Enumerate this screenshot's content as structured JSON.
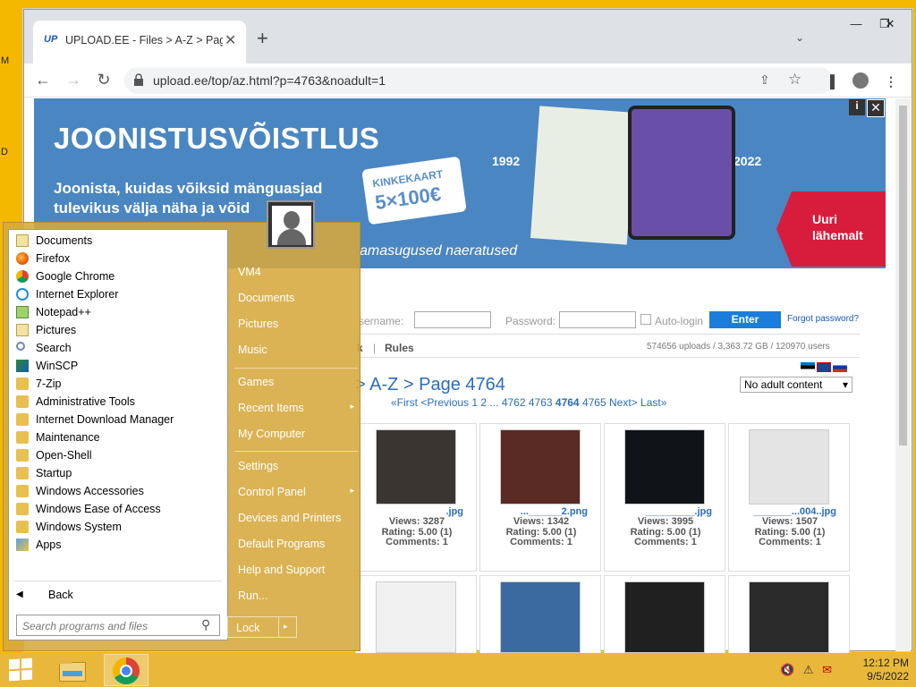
{
  "desktop": {
    "edge_letters": [
      "M",
      "D"
    ]
  },
  "browser": {
    "tab": {
      "favicon_text": "UP",
      "title": "UPLOAD.EE - Files > A-Z > Page",
      "close": "✕"
    },
    "new_tab": "+",
    "url": "upload.ee/top/az.html?p=4763&noadult=1"
  },
  "banner": {
    "heading": "JOONISTUSVÕISTLUS",
    "subtitle": "Joonista, kuidas võiksid mänguasjad tulevikus välja näha ja võid",
    "subtitle_tail": "amasugused naeratused",
    "card_line1": "KINKEKAART",
    "card_line2": "5×100€",
    "year_left": "1992",
    "year_right": "2022",
    "cta": "Uuri lähemalt",
    "info": "i",
    "close": "✕"
  },
  "login": {
    "username_label": "sername:",
    "password_label": "Password:",
    "autologin_label": "Auto-login",
    "enter_label": "Enter",
    "forgot_label": "Forgot password?"
  },
  "nav": {
    "partial_link": "k",
    "separator": "|",
    "rules": "Rules"
  },
  "stats": "574656 uploads  /  3,363.72 GB  /  120970 users",
  "filter": {
    "selected": "No adult content"
  },
  "page_title": "> A-Z > Page 4764",
  "pager": {
    "first": "«First",
    "previous": "<Previous",
    "p1": "1",
    "p2": "2",
    "ellipsis": "...",
    "p4762": "4762",
    "p4763": "4763",
    "current": "4764",
    "p4765": "4765",
    "next": "Next>",
    "last": "Last»"
  },
  "thumbnails": [
    {
      "name": ".jpg",
      "views": "Views: 3287",
      "rating": "Rating: 5.00 (1)",
      "comments": "Comments: 1",
      "img_color": "#3a3530"
    },
    {
      "name": "...______2.png",
      "views": "Views: 1342",
      "rating": "Rating: 5.00 (1)",
      "comments": "Comments: 1",
      "img_color": "#5a2a24"
    },
    {
      "name": "_________.jpg",
      "views": "Views: 3995",
      "rating": "Rating: 5.00 (1)",
      "comments": "Comments: 1",
      "img_color": "#101418"
    },
    {
      "name": "_______...004..jpg",
      "views": "Views: 1507",
      "rating": "Rating: 5.00 (1)",
      "comments": "Comments: 1",
      "img_color": "#e4e4e4"
    }
  ],
  "thumbnails_row2_colors": [
    "#f0f0f0",
    "#3a6aa0",
    "#202020",
    "#2a2a2a"
  ],
  "start_menu": {
    "programs": [
      {
        "label": "Documents",
        "icon": "documents-icon"
      },
      {
        "label": "Firefox",
        "icon": "firefox-icon"
      },
      {
        "label": "Google Chrome",
        "icon": "chrome-icon"
      },
      {
        "label": "Internet Explorer",
        "icon": "ie-icon"
      },
      {
        "label": "Notepad++",
        "icon": "notepadpp-icon"
      },
      {
        "label": "Pictures",
        "icon": "pictures-icon"
      },
      {
        "label": "Search",
        "icon": "search-icon"
      },
      {
        "label": "WinSCP",
        "icon": "winscp-icon"
      },
      {
        "label": "7-Zip",
        "icon": "folder-icon"
      },
      {
        "label": "Administrative Tools",
        "icon": "folder-icon"
      },
      {
        "label": "Internet Download Manager",
        "icon": "folder-icon"
      },
      {
        "label": "Maintenance",
        "icon": "folder-icon"
      },
      {
        "label": "Open-Shell",
        "icon": "folder-icon"
      },
      {
        "label": "Startup",
        "icon": "folder-icon"
      },
      {
        "label": "Windows Accessories",
        "icon": "folder-icon"
      },
      {
        "label": "Windows Ease of Access",
        "icon": "folder-icon"
      },
      {
        "label": "Windows System",
        "icon": "folder-icon"
      },
      {
        "label": "Apps",
        "icon": "apps-icon"
      }
    ],
    "back_label": "Back",
    "search_placeholder": "Search programs and files",
    "right_items": [
      {
        "label": "VM4"
      },
      {
        "label": "Documents"
      },
      {
        "label": "Pictures"
      },
      {
        "label": "Music"
      },
      {
        "label": "Games"
      },
      {
        "label": "Recent Items"
      },
      {
        "label": "My Computer"
      },
      {
        "label": "Settings"
      },
      {
        "label": "Control Panel"
      },
      {
        "label": "Devices and Printers"
      },
      {
        "label": "Default Programs"
      },
      {
        "label": "Help and Support"
      },
      {
        "label": "Run..."
      }
    ],
    "lock_label": "Lock"
  },
  "taskbar": {
    "time": "12:12 PM",
    "date": "9/5/2022"
  },
  "colors": {
    "accent_blue": "#1b7ddb",
    "link_blue": "#2a6db8",
    "taskbar": "#e9b83b",
    "desktop": "#f5b800"
  }
}
